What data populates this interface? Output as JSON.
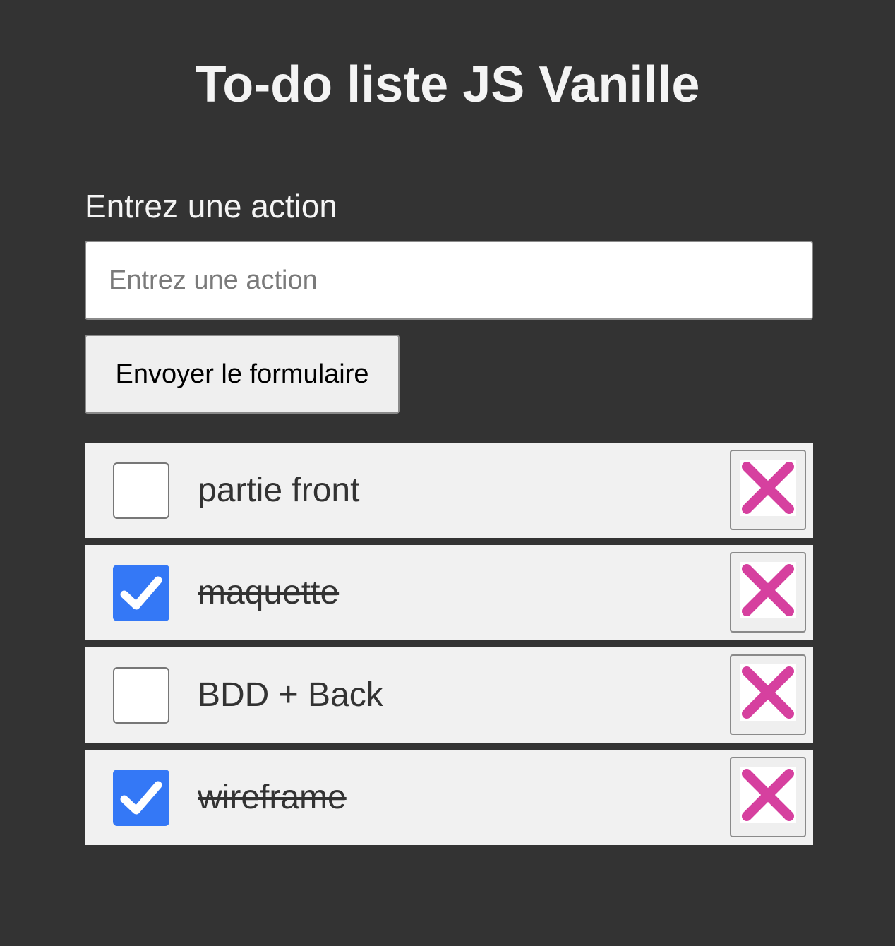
{
  "header": {
    "title": "To-do liste JS Vanille"
  },
  "form": {
    "label": "Entrez une action",
    "input_placeholder": "Entrez une action",
    "input_value": "",
    "submit_label": "Envoyer le formulaire"
  },
  "todos": [
    {
      "text": "partie front",
      "done": false
    },
    {
      "text": "maquette",
      "done": true
    },
    {
      "text": "BDD + Back",
      "done": false
    },
    {
      "text": "wireframe",
      "done": true
    }
  ],
  "icons": {
    "check": "check-icon",
    "delete": "close-x-icon"
  },
  "colors": {
    "background": "#333333",
    "item_background": "#f1f1f1",
    "checkbox_checked": "#3478f6",
    "delete_x": "#d6409f"
  }
}
